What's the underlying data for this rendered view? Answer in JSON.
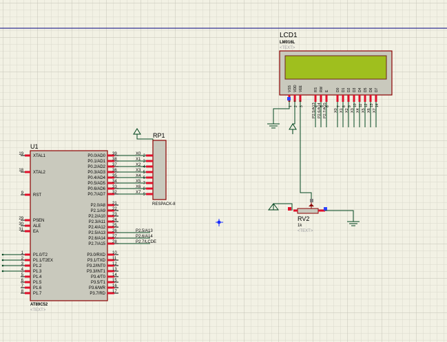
{
  "colors": {
    "background": "#f2f1e4",
    "grid_fine": "#d9d9cc",
    "grid_major": "#c4c4b6",
    "frame_line": "#000080",
    "component_border": "#8b0000",
    "component_fill": "#c9c9bd",
    "lcd_screen": "#9fbf1e",
    "pin_marker": "#e0102a",
    "pin_blue": "#2f43ff",
    "wire": "#00451e",
    "text": "#000000",
    "ghost_text": "#9a9aa0"
  },
  "cursor_icon": "crosshair-icon",
  "lcd": {
    "ref": "LCD1",
    "part": "LM016L",
    "ghost": "<TEXT>",
    "top_pins": [
      "VSS",
      "VDD",
      "VEE",
      "RS",
      "RW",
      "E",
      "D0",
      "D1",
      "D2",
      "D3",
      "D4",
      "D5",
      "D6",
      "D7"
    ],
    "pin_numbers": [
      "1",
      "2",
      "3",
      "4",
      "5",
      "6",
      "7",
      "8",
      "9",
      "10",
      "11",
      "12",
      "13",
      "14"
    ],
    "ctrl_nets": [
      "P2.5/A13",
      "P2.6/A14",
      "P2.7/A15"
    ],
    "data_nets": [
      "X0",
      "X1",
      "X2",
      "X3",
      "X4",
      "X5",
      "X6",
      "X7"
    ]
  },
  "rp1": {
    "ref": "RP1",
    "part": "RESPACK-8",
    "pin_numbers": [
      "2",
      "3",
      "4",
      "5",
      "6",
      "7",
      "8",
      "9"
    ],
    "net_labels": [
      "X0",
      "X1",
      "X2",
      "X3",
      "X4",
      "X5",
      "X6",
      "X7"
    ]
  },
  "u1": {
    "ref": "U1",
    "part": "AT89C52",
    "ghost": "<TEXT>",
    "left_pins": [
      {
        "num": "19",
        "name": "XTAL1"
      },
      {
        "num": "18",
        "name": "XTAL2"
      },
      {
        "num": "9",
        "name": "RST"
      },
      {
        "num": "29",
        "name": "PSEN"
      },
      {
        "num": "30",
        "name": "ALE"
      },
      {
        "num": "31",
        "name": "EA"
      },
      {
        "num": "1",
        "name": "P1.0/T2"
      },
      {
        "num": "2",
        "name": "P1.1/T2EX"
      },
      {
        "num": "3",
        "name": "P1.2"
      },
      {
        "num": "4",
        "name": "P1.3"
      },
      {
        "num": "5",
        "name": "P1.4"
      },
      {
        "num": "6",
        "name": "P1.5"
      },
      {
        "num": "7",
        "name": "P1.6"
      },
      {
        "num": "8",
        "name": "P1.7"
      }
    ],
    "right_pins": [
      {
        "num": "39",
        "name": "P0.0/AD0"
      },
      {
        "num": "38",
        "name": "P0.1/AD1"
      },
      {
        "num": "37",
        "name": "P0.2/AD2"
      },
      {
        "num": "36",
        "name": "P0.3/AD3"
      },
      {
        "num": "35",
        "name": "P0.4/AD4"
      },
      {
        "num": "34",
        "name": "P0.5/AD5"
      },
      {
        "num": "33",
        "name": "P0.6/AD6"
      },
      {
        "num": "32",
        "name": "P0.7/AD7"
      },
      {
        "num": "21",
        "name": "P2.0/A8"
      },
      {
        "num": "22",
        "name": "P2.1/A9"
      },
      {
        "num": "23",
        "name": "P2.2/A10"
      },
      {
        "num": "24",
        "name": "P2.3/A11"
      },
      {
        "num": "25",
        "name": "P2.4/A12"
      },
      {
        "num": "26",
        "name": "P2.5/A13"
      },
      {
        "num": "27",
        "name": "P2.6/A14"
      },
      {
        "num": "28",
        "name": "P2.7/A15"
      },
      {
        "num": "10",
        "name": "P3.0/RXD"
      },
      {
        "num": "11",
        "name": "P3.1/TXD"
      },
      {
        "num": "12",
        "name": "P3.2/INT0"
      },
      {
        "num": "13",
        "name": "P3.3/INT1"
      },
      {
        "num": "14",
        "name": "P3.4/T0"
      },
      {
        "num": "15",
        "name": "P3.5/T1"
      },
      {
        "num": "16",
        "name": "P3.6/WR"
      },
      {
        "num": "17",
        "name": "P3.7/RD"
      }
    ],
    "p0_nets": [
      "X0",
      "X1",
      "X2",
      "X3",
      "X4",
      "X5",
      "X6",
      "X7"
    ],
    "p2_nets": [
      "P2.5/A13",
      "P2.6/A14",
      "P2.7/LCDE"
    ]
  },
  "rv2": {
    "ref": "RV2",
    "value": "1k",
    "ghost": "<TEXT>"
  }
}
